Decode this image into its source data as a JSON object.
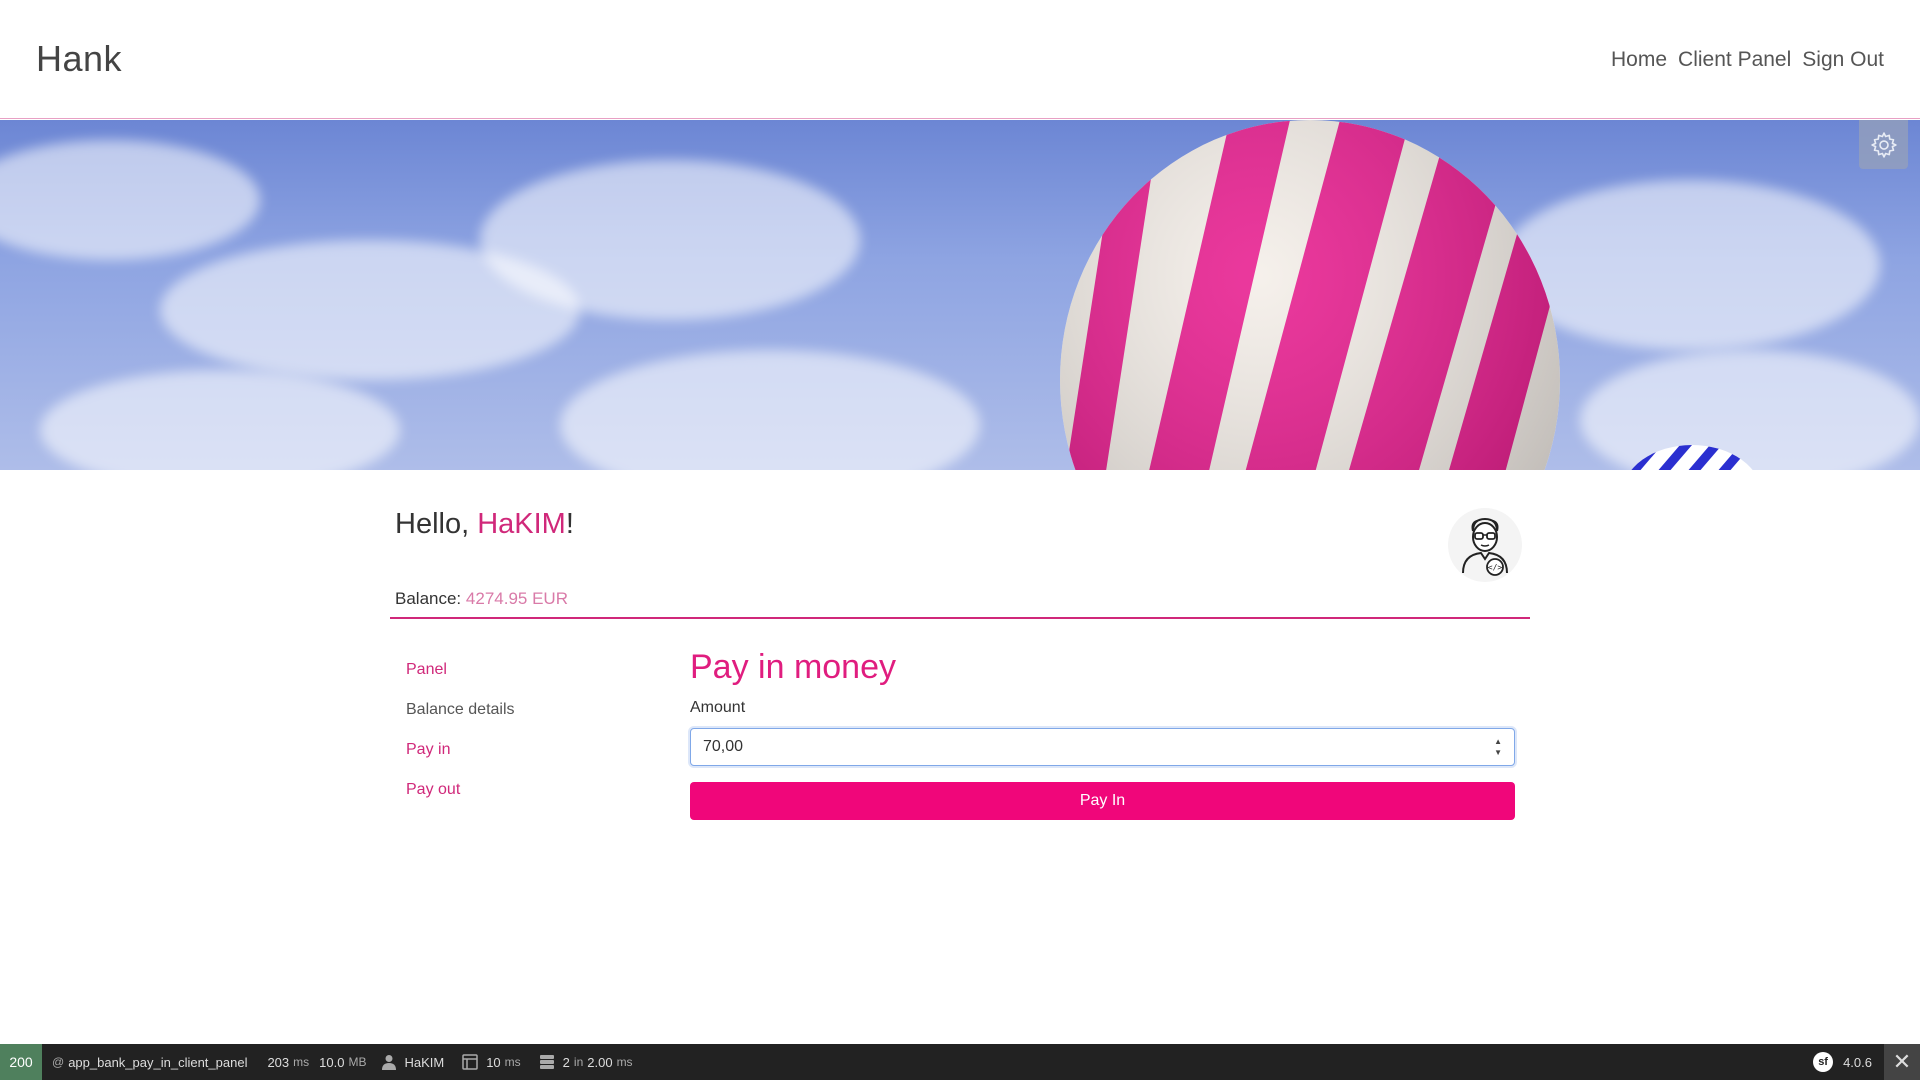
{
  "header": {
    "brand": "Hank",
    "nav": [
      "Home",
      "Client Panel",
      "Sign Out"
    ]
  },
  "hero": {
    "settings_icon": "gear-icon"
  },
  "greeting": {
    "prefix": "Hello, ",
    "user": "HaKIM",
    "suffix": "!"
  },
  "balance": {
    "label": "Balance:",
    "value": "4274.95 EUR"
  },
  "sidebar": {
    "items": [
      {
        "label": "Panel"
      },
      {
        "label": "Balance details"
      },
      {
        "label": "Pay in"
      },
      {
        "label": "Pay out"
      }
    ]
  },
  "form": {
    "title": "Pay in money",
    "amount_label": "Amount",
    "amount_value": "70,00",
    "submit_label": "Pay In"
  },
  "debug_toolbar": {
    "status": "200",
    "route": "app_bank_pay_in_client_panel",
    "time_value": "203",
    "time_unit": "ms",
    "memory_value": "10.0",
    "memory_unit": "MB",
    "user": "HaKIM",
    "render_value": "10",
    "render_unit": "ms",
    "db_queries": "2",
    "db_in": "in",
    "db_time": "2.00",
    "db_unit": "ms",
    "version": "4.0.6",
    "brand_colors": {
      "status_ok": "#4f805d",
      "accent": "#e01d7f"
    }
  }
}
